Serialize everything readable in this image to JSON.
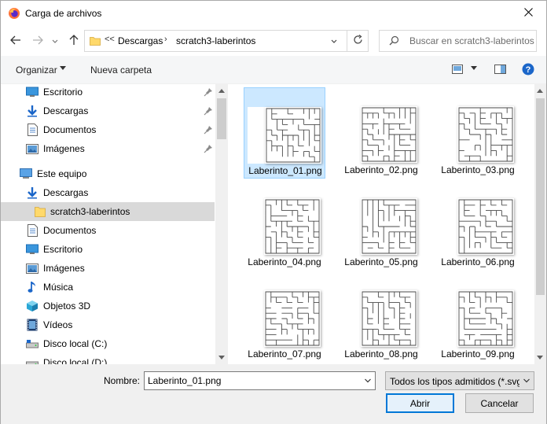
{
  "window": {
    "title": "Carga de archivos"
  },
  "address": {
    "overflow": "<<",
    "crumbs": [
      "Descargas",
      "scratch3-laberintos"
    ]
  },
  "search": {
    "placeholder": "Buscar en scratch3-laberintos"
  },
  "toolbar": {
    "organize_label": "Organizar",
    "new_folder_label": "Nueva carpeta"
  },
  "sidebar": {
    "quick_access": [
      {
        "label": "Escritorio",
        "icon": "desktop-icon"
      },
      {
        "label": "Descargas",
        "icon": "download-icon"
      },
      {
        "label": "Documentos",
        "icon": "document-icon"
      },
      {
        "label": "Imágenes",
        "icon": "pictures-icon"
      }
    ],
    "this_pc_label": "Este equipo",
    "this_pc": [
      {
        "label": "Descargas",
        "icon": "download-icon"
      },
      {
        "label": "scratch3-laberintos",
        "icon": "folder-icon",
        "selected": true
      },
      {
        "label": "Documentos",
        "icon": "document-icon"
      },
      {
        "label": "Escritorio",
        "icon": "desktop-icon"
      },
      {
        "label": "Imágenes",
        "icon": "pictures-icon"
      },
      {
        "label": "Música",
        "icon": "music-icon"
      },
      {
        "label": "Objetos 3D",
        "icon": "objects-3d-icon"
      },
      {
        "label": "Vídeos",
        "icon": "videos-icon"
      },
      {
        "label": "Disco local (C:)",
        "icon": "drive-icon"
      },
      {
        "label": "Disco local (D:)",
        "icon": "drive-icon"
      }
    ]
  },
  "files": [
    {
      "name": "Laberinto_01.png",
      "selected": true
    },
    {
      "name": "Laberinto_02.png"
    },
    {
      "name": "Laberinto_03.png"
    },
    {
      "name": "Laberinto_04.png"
    },
    {
      "name": "Laberinto_05.png"
    },
    {
      "name": "Laberinto_06.png"
    },
    {
      "name": "Laberinto_07.png"
    },
    {
      "name": "Laberinto_08.png"
    },
    {
      "name": "Laberinto_09.png"
    }
  ],
  "footer": {
    "name_label": "Nombre:",
    "name_value": "Laberinto_01.png",
    "filter_value": "Todos los tipos admitidos (*.svg",
    "open_label": "Abrir",
    "cancel_label": "Cancelar"
  },
  "colors": {
    "accent": "#0078d7",
    "selection": "#cce8ff",
    "folder": "#ffd96b"
  }
}
